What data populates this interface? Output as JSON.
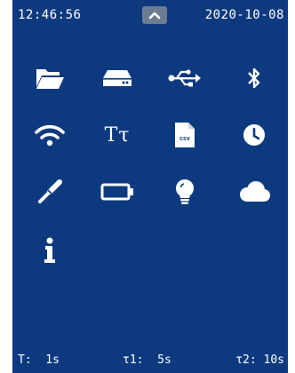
{
  "header": {
    "time": "12:46:56",
    "date": "2020-10-08",
    "expand_icon": "chevron-up-icon"
  },
  "menu": {
    "items": [
      {
        "icon": "folder-icon"
      },
      {
        "icon": "drive-icon"
      },
      {
        "icon": "usb-icon"
      },
      {
        "icon": "bluetooth-icon"
      },
      {
        "icon": "wifi-icon"
      },
      {
        "icon": "font-icon",
        "label": "Tτ"
      },
      {
        "icon": "csv-file-icon",
        "label": "csv"
      },
      {
        "icon": "clock-icon"
      },
      {
        "icon": "probe-icon"
      },
      {
        "icon": "battery-icon"
      },
      {
        "icon": "lightbulb-icon"
      },
      {
        "icon": "cloud-icon"
      },
      {
        "icon": "info-icon"
      }
    ]
  },
  "footer": {
    "t": "T:  1s",
    "tau1": "τ1:  5s",
    "tau2": "τ2: 10s"
  },
  "colors": {
    "background": "#0d3a7e",
    "foreground": "#ffffff",
    "button": "#6d7b90"
  }
}
